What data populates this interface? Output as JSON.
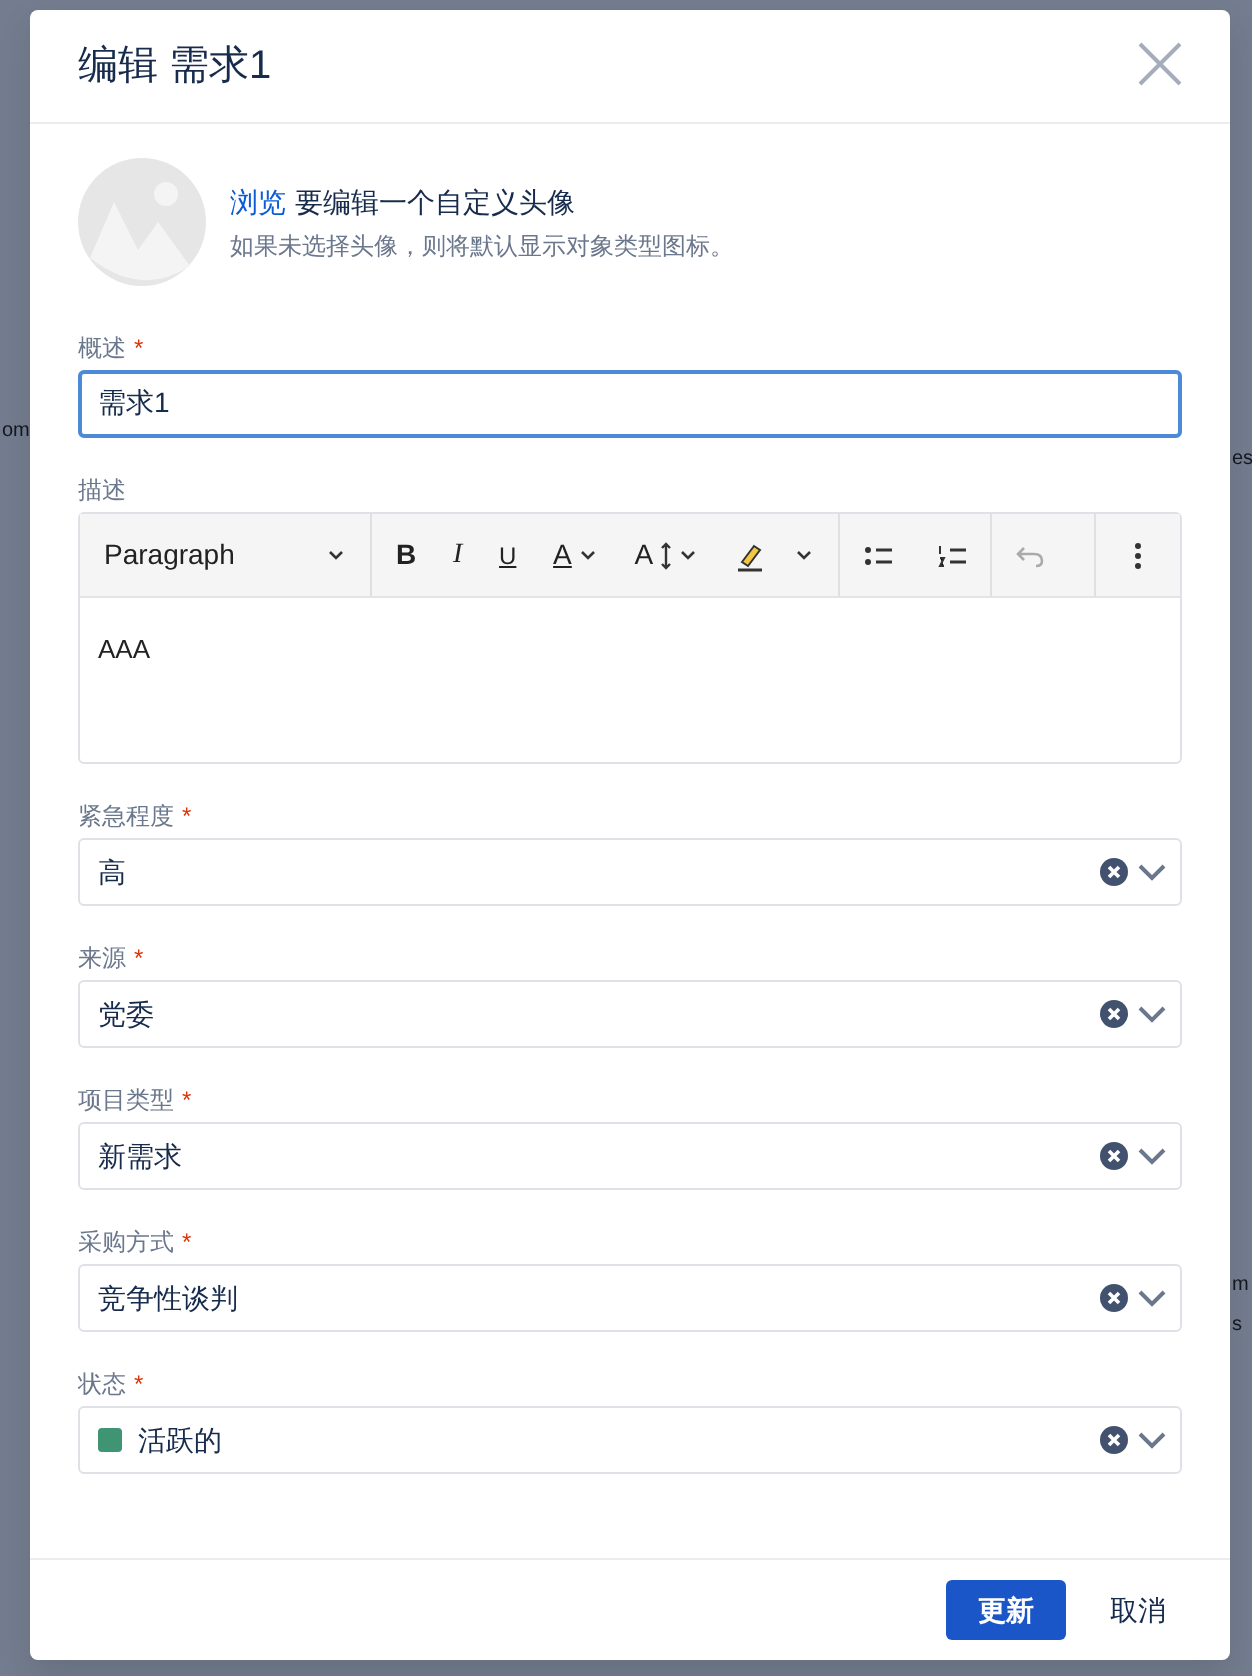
{
  "backdrop_fragments": [
    {
      "text": "om"
    },
    {
      "text": "es"
    },
    {
      "text": "m"
    },
    {
      "text": "s"
    }
  ],
  "required_marker": "*",
  "dialog": {
    "title": "编辑 需求1"
  },
  "avatar": {
    "link": "浏览",
    "text": "要编辑一个自定义头像",
    "hint": "如果未选择头像，则将默认显示对象类型图标。"
  },
  "fields": [
    {
      "kind": "text",
      "label": "概述",
      "required": true,
      "value": "需求1",
      "focused": true
    },
    {
      "kind": "editor",
      "label": "描述",
      "required": false,
      "style": "Paragraph",
      "bold": "B",
      "italic": "I",
      "underline": "U",
      "font_color": "A",
      "font_size": "A",
      "content": "AAA"
    },
    {
      "kind": "select",
      "label": "紧急程度",
      "required": true,
      "value": "高"
    },
    {
      "kind": "select",
      "label": "来源",
      "required": true,
      "value": "党委"
    },
    {
      "kind": "select",
      "label": "项目类型",
      "required": true,
      "value": "新需求"
    },
    {
      "kind": "select",
      "label": "采购方式",
      "required": true,
      "value": "竞争性谈判"
    },
    {
      "kind": "select",
      "label": "状态",
      "required": true,
      "value": "活跃的",
      "color": "#3f9474"
    }
  ],
  "buttons": [
    {
      "label": "更新",
      "kind": "primary"
    },
    {
      "label": "取消",
      "kind": "link"
    }
  ]
}
